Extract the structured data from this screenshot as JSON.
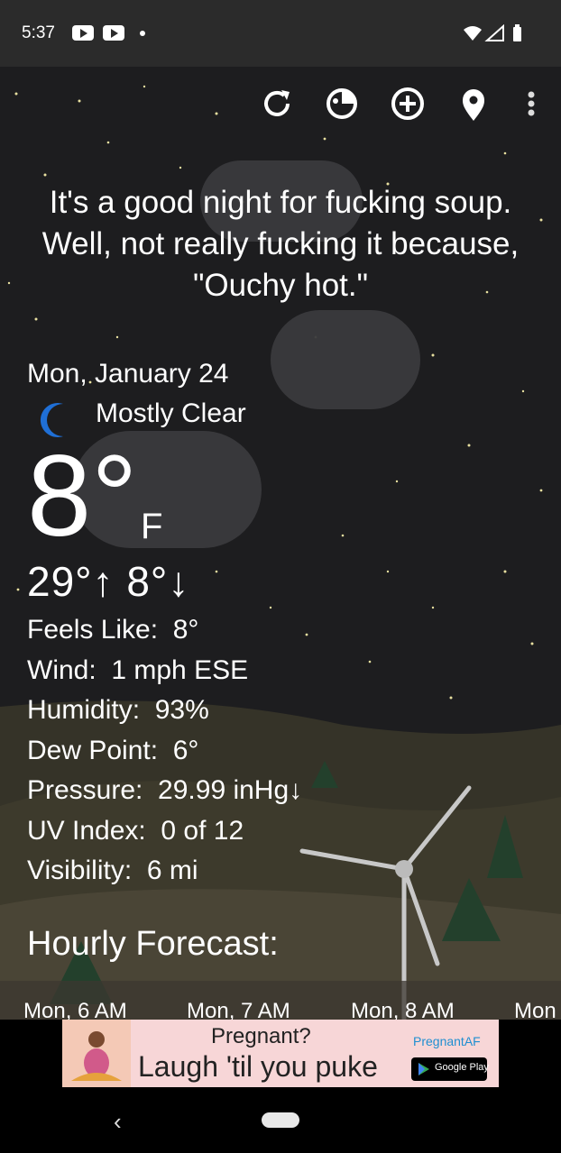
{
  "status_bar": {
    "time": "5:37"
  },
  "toolbar": {
    "icons": [
      "refresh-icon",
      "radar-icon",
      "add-icon",
      "location-icon",
      "more-options-icon"
    ]
  },
  "quote": "It's a good night for fucking soup. Well, not really fucking it because, \"Ouchy hot.\"",
  "current": {
    "date": "Mon, January 24",
    "condition": "Mostly Clear",
    "condition_icon": "moon-icon",
    "temperature": "8°",
    "unit": "F",
    "high_low": "29°↑ 8°↓"
  },
  "details": [
    "Feels Like:  8°",
    "Wind:  1 mph ESE",
    "Humidity:  93%",
    "Dew Point:  6°",
    "Pressure:  29.99 inHg↓",
    "UV Index:  0 of 12",
    "Visibility:  6 mi"
  ],
  "hourly": {
    "title": "Hourly Forecast:",
    "labels": [
      "Mon, 6 AM",
      "Mon, 7 AM",
      "Mon, 8 AM",
      "Mon"
    ]
  },
  "ad": {
    "line1": "Pregnant?",
    "line2": "Laugh 'til you puke",
    "brand": "PregnantAF",
    "store_badge": "Google Play"
  },
  "colors": {
    "sky": "#1d1d1f",
    "status_bar": "#2b2b2b",
    "moon": "#1f6fd6",
    "ad_background": "#f7d6d7",
    "ad_brand": "#1f8fd1"
  }
}
